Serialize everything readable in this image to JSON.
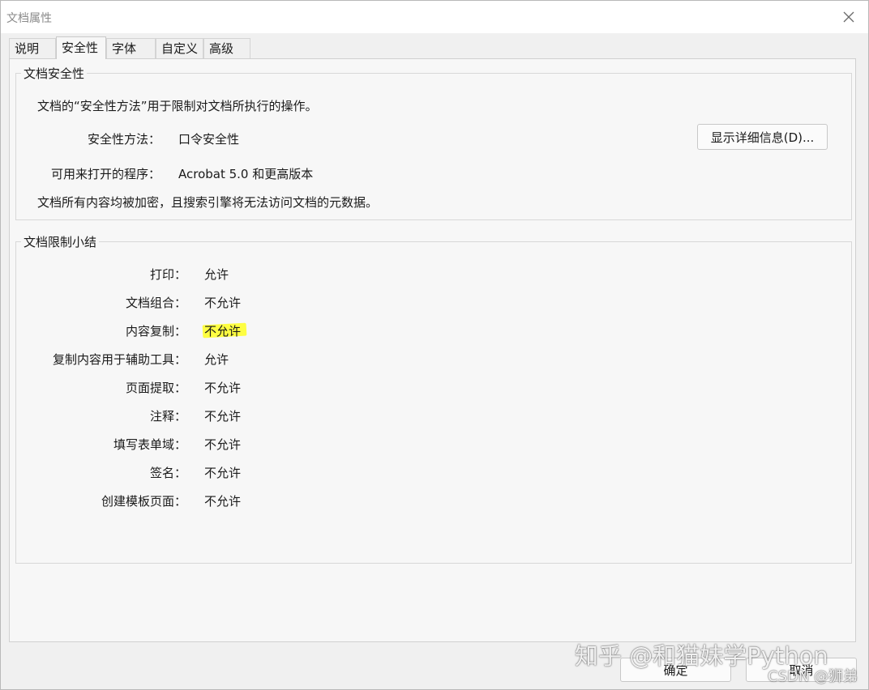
{
  "window": {
    "title": "文档属性"
  },
  "tabs": [
    {
      "label": "说明"
    },
    {
      "label": "安全性"
    },
    {
      "label": "字体"
    },
    {
      "label": "自定义"
    },
    {
      "label": "高级"
    }
  ],
  "active_tab_index": 1,
  "security": {
    "group_title": "文档安全性",
    "description": "文档的“安全性方法”用于限制对文档所执行的操作。",
    "method_label": "安全性方法：",
    "method_value": "口令安全性",
    "details_button": "显示详细信息(D)...",
    "compat_label": "可用来打开的程序：",
    "compat_value": "Acrobat 5.0 和更高版本",
    "encryption_note": "文档所有内容均被加密，且搜索引擎将无法访问文档的元数据。"
  },
  "restrictions": {
    "group_title": "文档限制小结",
    "items": [
      {
        "label": "打印：",
        "value": "允许"
      },
      {
        "label": "文档组合：",
        "value": "不允许"
      },
      {
        "label": "内容复制：",
        "value": "不允许",
        "highlighted": true
      },
      {
        "label": "复制内容用于辅助工具：",
        "value": "允许"
      },
      {
        "label": "页面提取：",
        "value": "不允许"
      },
      {
        "label": "注释：",
        "value": "不允许"
      },
      {
        "label": "填写表单域：",
        "value": "不允许"
      },
      {
        "label": "签名：",
        "value": "不允许"
      },
      {
        "label": "创建模板页面：",
        "value": "不允许"
      }
    ],
    "highlight_color": "#ffff22"
  },
  "buttons": {
    "ok": "确定",
    "cancel": "取消"
  },
  "watermarks": {
    "zhihu": "知乎 @和猫妹学Python",
    "csdn": "CSDN @狮弟"
  }
}
